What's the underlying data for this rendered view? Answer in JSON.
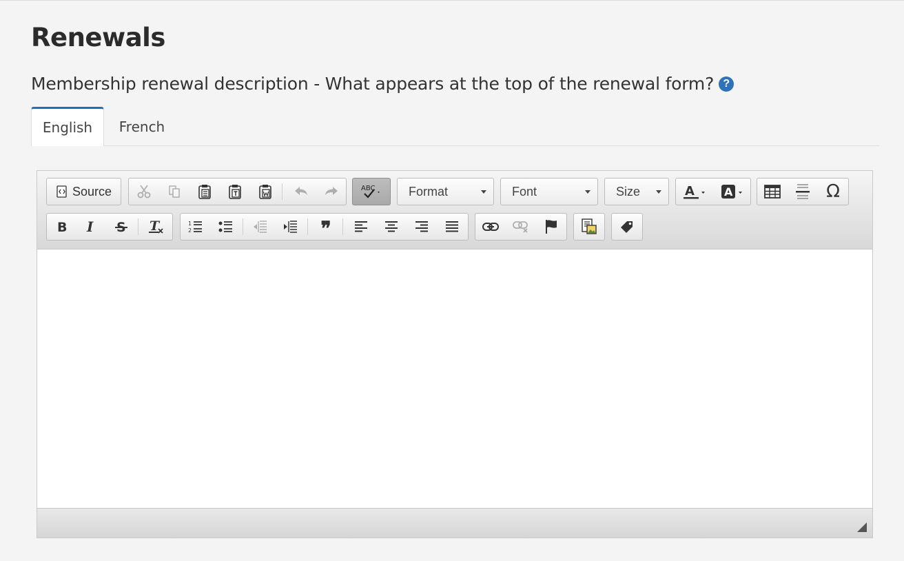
{
  "page": {
    "title": "Renewals",
    "description": "Membership renewal description - What appears at the top of the renewal form?",
    "help_icon": "?"
  },
  "tabs": [
    {
      "label": "English",
      "active": true
    },
    {
      "label": "French",
      "active": false
    }
  ],
  "toolbar": {
    "source_label": "Source",
    "format_label": "Format",
    "font_label": "Font",
    "size_label": "Size",
    "special_char": "Ω",
    "quote_glyph": "❞"
  },
  "colors": {
    "accent": "#1f6fb5",
    "help": "#2f72b8",
    "background": "#f4f4f4"
  }
}
